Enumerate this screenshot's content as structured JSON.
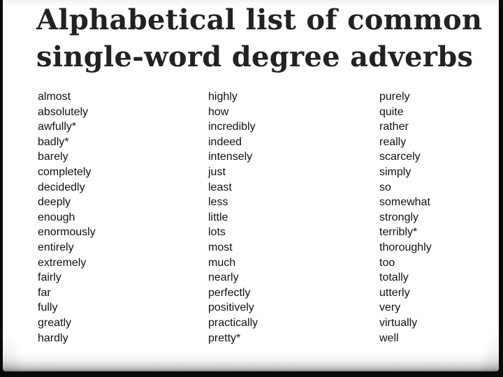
{
  "slide": {
    "title_line_1": "Alphabetical list of common",
    "title_line_2": "single-word degree adverbs",
    "columns": [
      {
        "items": [
          "almost",
          "absolutely",
          "awfully*",
          "badly*",
          "barely",
          "completely",
          "decidedly",
          "deeply",
          "enough",
          "enormously",
          "entirely",
          "extremely",
          "fairly",
          "far",
          "fully",
          "greatly",
          "hardly"
        ]
      },
      {
        "items": [
          "highly",
          "how",
          "incredibly",
          "indeed",
          "intensely",
          "just",
          "least",
          "less",
          "little",
          "lots",
          "most",
          "much",
          "nearly",
          "perfectly",
          "positively",
          "practically",
          "pretty*"
        ]
      },
      {
        "items": [
          "purely",
          "quite",
          "rather",
          "really",
          "scarcely",
          "simply",
          "so",
          "somewhat",
          "strongly",
          "terribly*",
          "thoroughly",
          "too",
          "totally",
          "utterly",
          "very",
          "virtually",
          "well"
        ]
      }
    ]
  }
}
